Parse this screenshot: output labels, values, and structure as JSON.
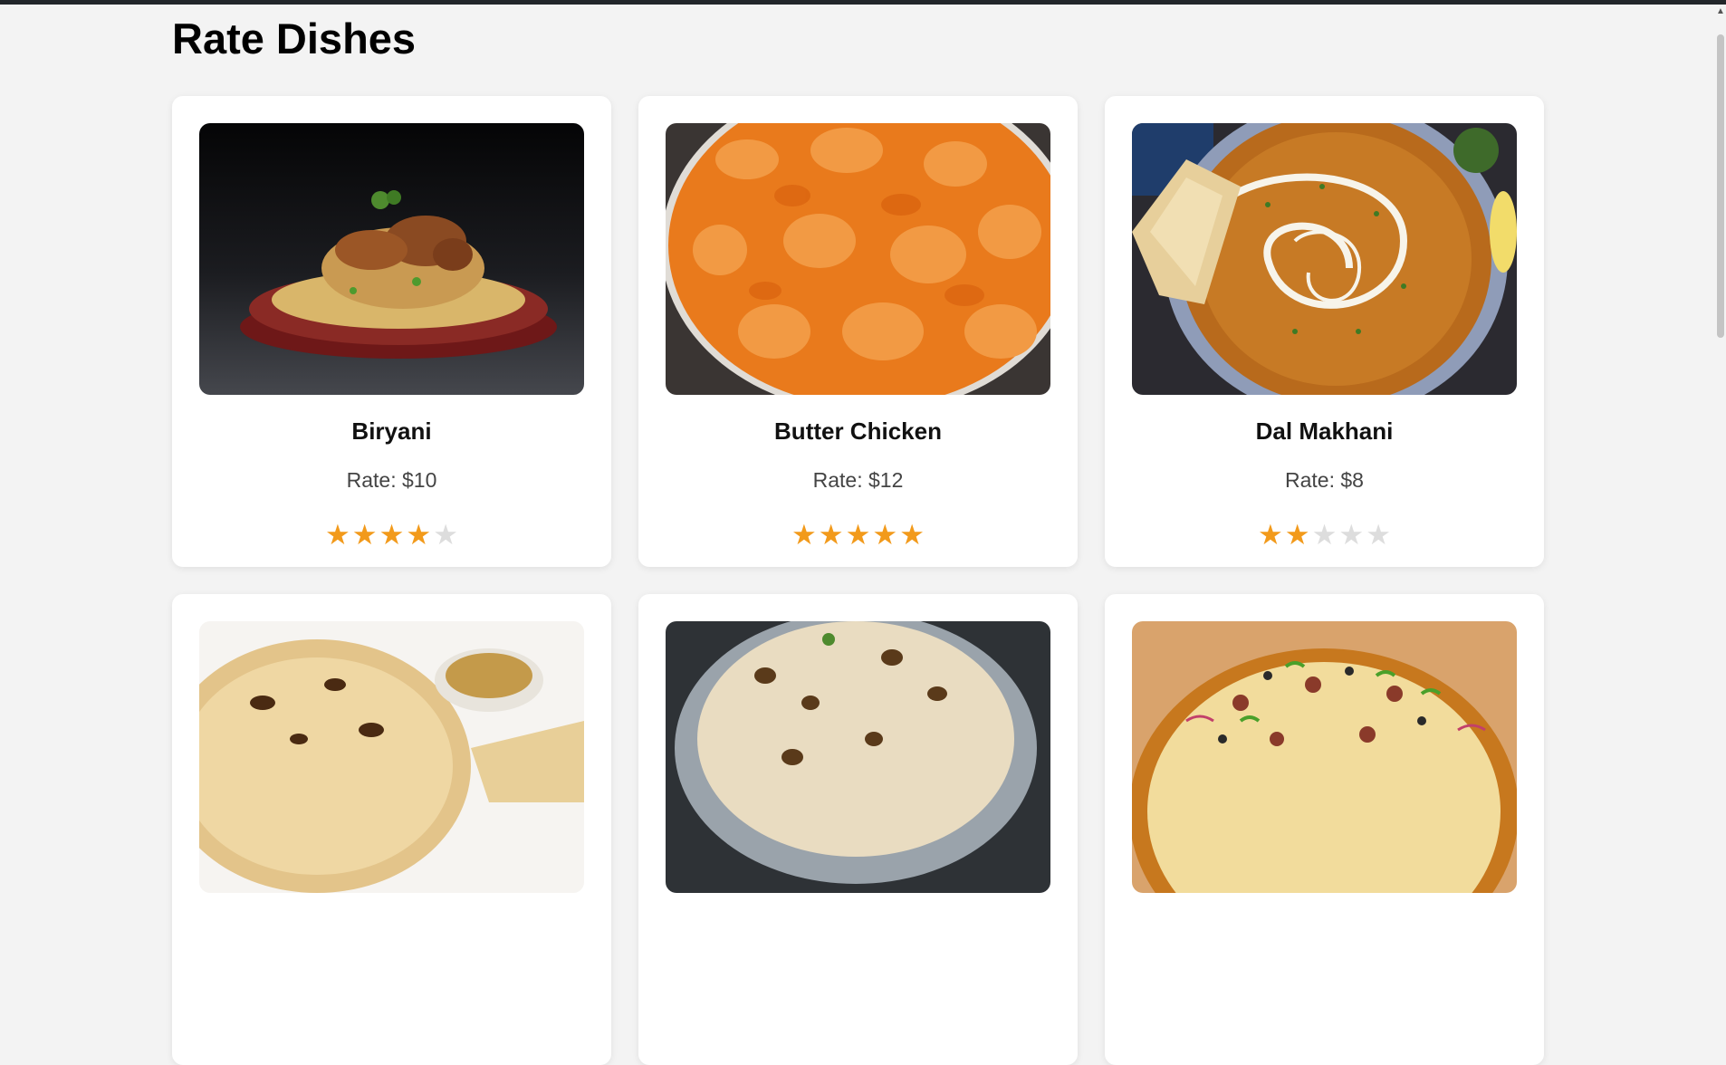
{
  "page": {
    "title": "Rate Dishes"
  },
  "colors": {
    "star_on": "#f29a1b",
    "star_off": "#dddddd",
    "background": "#f3f3f3"
  },
  "dishes": [
    {
      "name": "Biryani",
      "rate": "Rate: $10",
      "rating": 4,
      "max": 5,
      "image": "biryani-photo"
    },
    {
      "name": "Butter Chicken",
      "rate": "Rate: $12",
      "rating": 5,
      "max": 5,
      "image": "butter-chicken-photo"
    },
    {
      "name": "Dal Makhani",
      "rate": "Rate: $8",
      "rating": 2,
      "max": 5,
      "image": "dal-makhani-photo"
    },
    {
      "image": "paratha-photo"
    },
    {
      "image": "naan-photo"
    },
    {
      "image": "pizza-photo"
    }
  ]
}
